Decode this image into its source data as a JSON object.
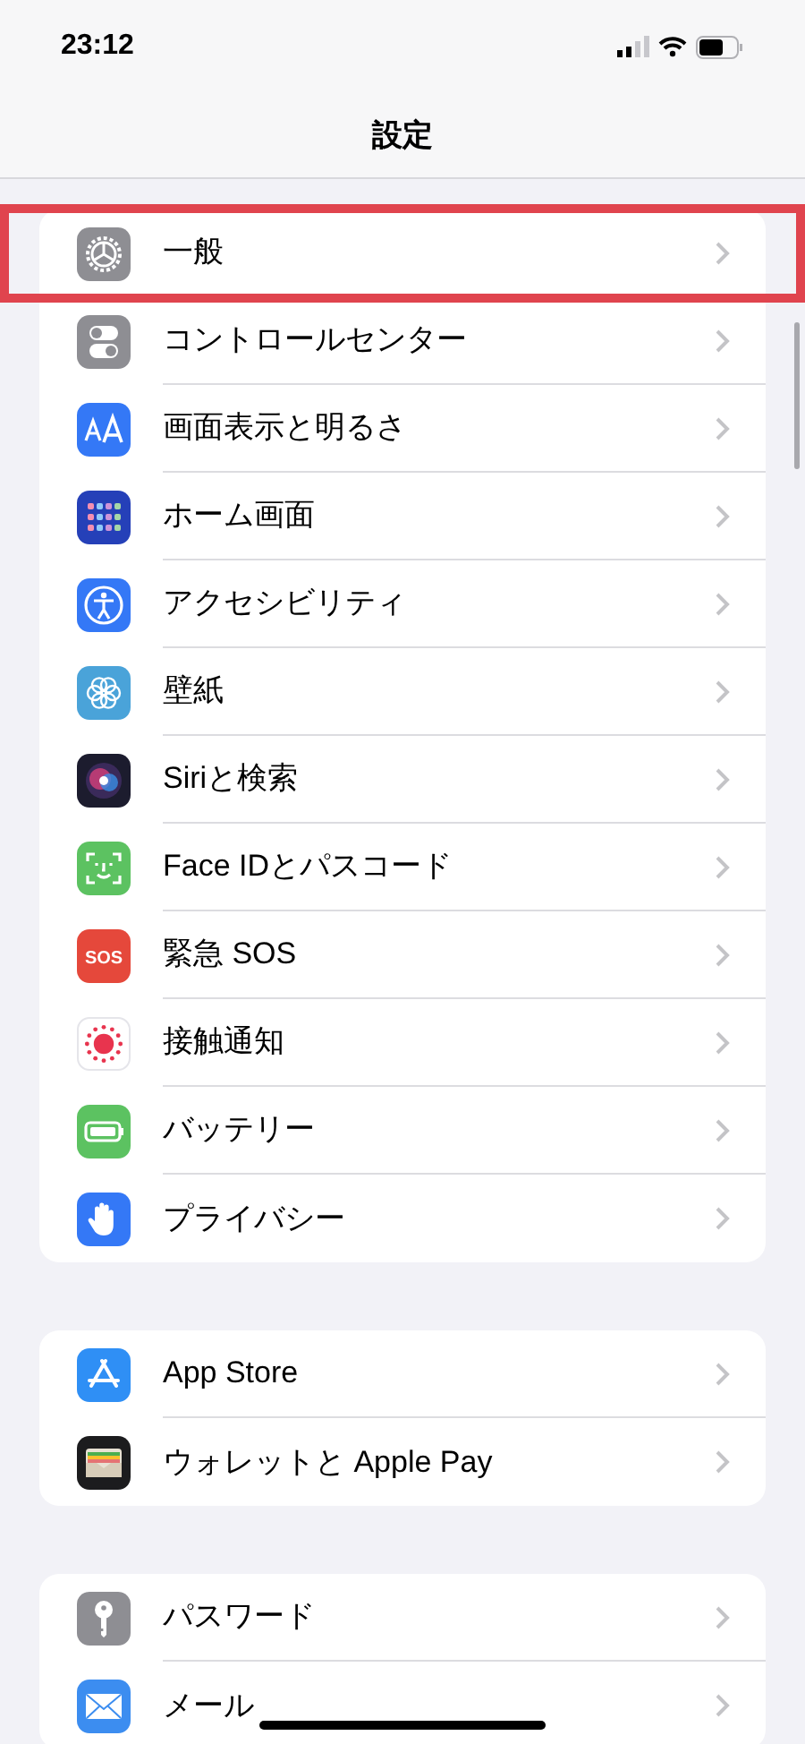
{
  "status_bar": {
    "time": "23:12"
  },
  "nav": {
    "title": "設定"
  },
  "groups": [
    {
      "items": [
        {
          "label": "一般",
          "kind": "gear",
          "highlighted": true
        },
        {
          "label": "コントロールセンター",
          "kind": "toggles",
          "highlighted": false
        },
        {
          "label": "画面表示と明るさ",
          "kind": "text-size",
          "highlighted": false
        },
        {
          "label": "ホーム画面",
          "kind": "grid",
          "highlighted": false
        },
        {
          "label": "アクセシビリティ",
          "kind": "person",
          "highlighted": false
        },
        {
          "label": "壁紙",
          "kind": "flower",
          "highlighted": false
        },
        {
          "label": "Siriと検索",
          "kind": "orb",
          "highlighted": false
        },
        {
          "label": "Face IDとパスコード",
          "kind": "face",
          "highlighted": false
        },
        {
          "label": "緊急 SOS",
          "kind": "sos",
          "icon_text": "SOS",
          "highlighted": false
        },
        {
          "label": "接触通知",
          "kind": "dots",
          "highlighted": false
        },
        {
          "label": "バッテリー",
          "kind": "battery",
          "highlighted": false
        },
        {
          "label": "プライバシー",
          "kind": "hand",
          "highlighted": false
        }
      ]
    },
    {
      "items": [
        {
          "label": "App Store",
          "kind": "appstore",
          "highlighted": false
        },
        {
          "label": "ウォレットと Apple Pay",
          "kind": "wallet",
          "highlighted": false
        }
      ]
    },
    {
      "items": [
        {
          "label": "パスワード",
          "kind": "key",
          "highlighted": false
        },
        {
          "label": "メール",
          "kind": "mail",
          "highlighted": false
        }
      ]
    }
  ]
}
